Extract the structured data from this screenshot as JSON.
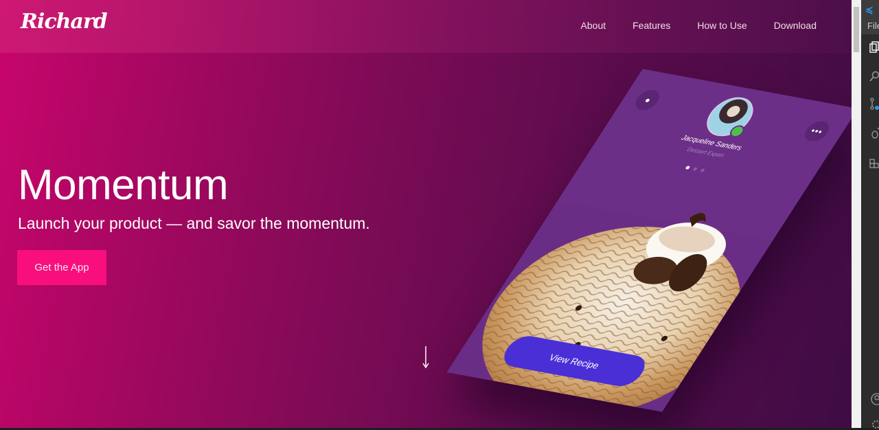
{
  "brand": {
    "logo_text": "Richard"
  },
  "nav": {
    "items": [
      {
        "label": "About"
      },
      {
        "label": "Features"
      },
      {
        "label": "How to Use"
      },
      {
        "label": "Download"
      }
    ]
  },
  "hero": {
    "title": "Momentum",
    "subtitle": "Launch your product — and savor the momentum.",
    "cta_label": "Get the App",
    "scroll_icon": "arrow-down-icon"
  },
  "phone": {
    "profile_name": "Jacqueline Sanders",
    "profile_role": "Dessert Expert",
    "more_label": "•••",
    "pager_count": 3,
    "pager_active": 1,
    "button_label": "View Recipe",
    "image": "ice-cream-with-coffee-beans"
  },
  "editor": {
    "file_menu": "File",
    "icons": [
      "explorer-icon",
      "search-icon",
      "source-control-icon",
      "debug-icon",
      "extensions-icon",
      "account-icon",
      "settings-gear-icon"
    ]
  },
  "colors": {
    "cta": "#f80f7d",
    "view_recipe": "#4a2fd6",
    "phone_bg": "#6a2d85",
    "online": "#4cc24a"
  }
}
